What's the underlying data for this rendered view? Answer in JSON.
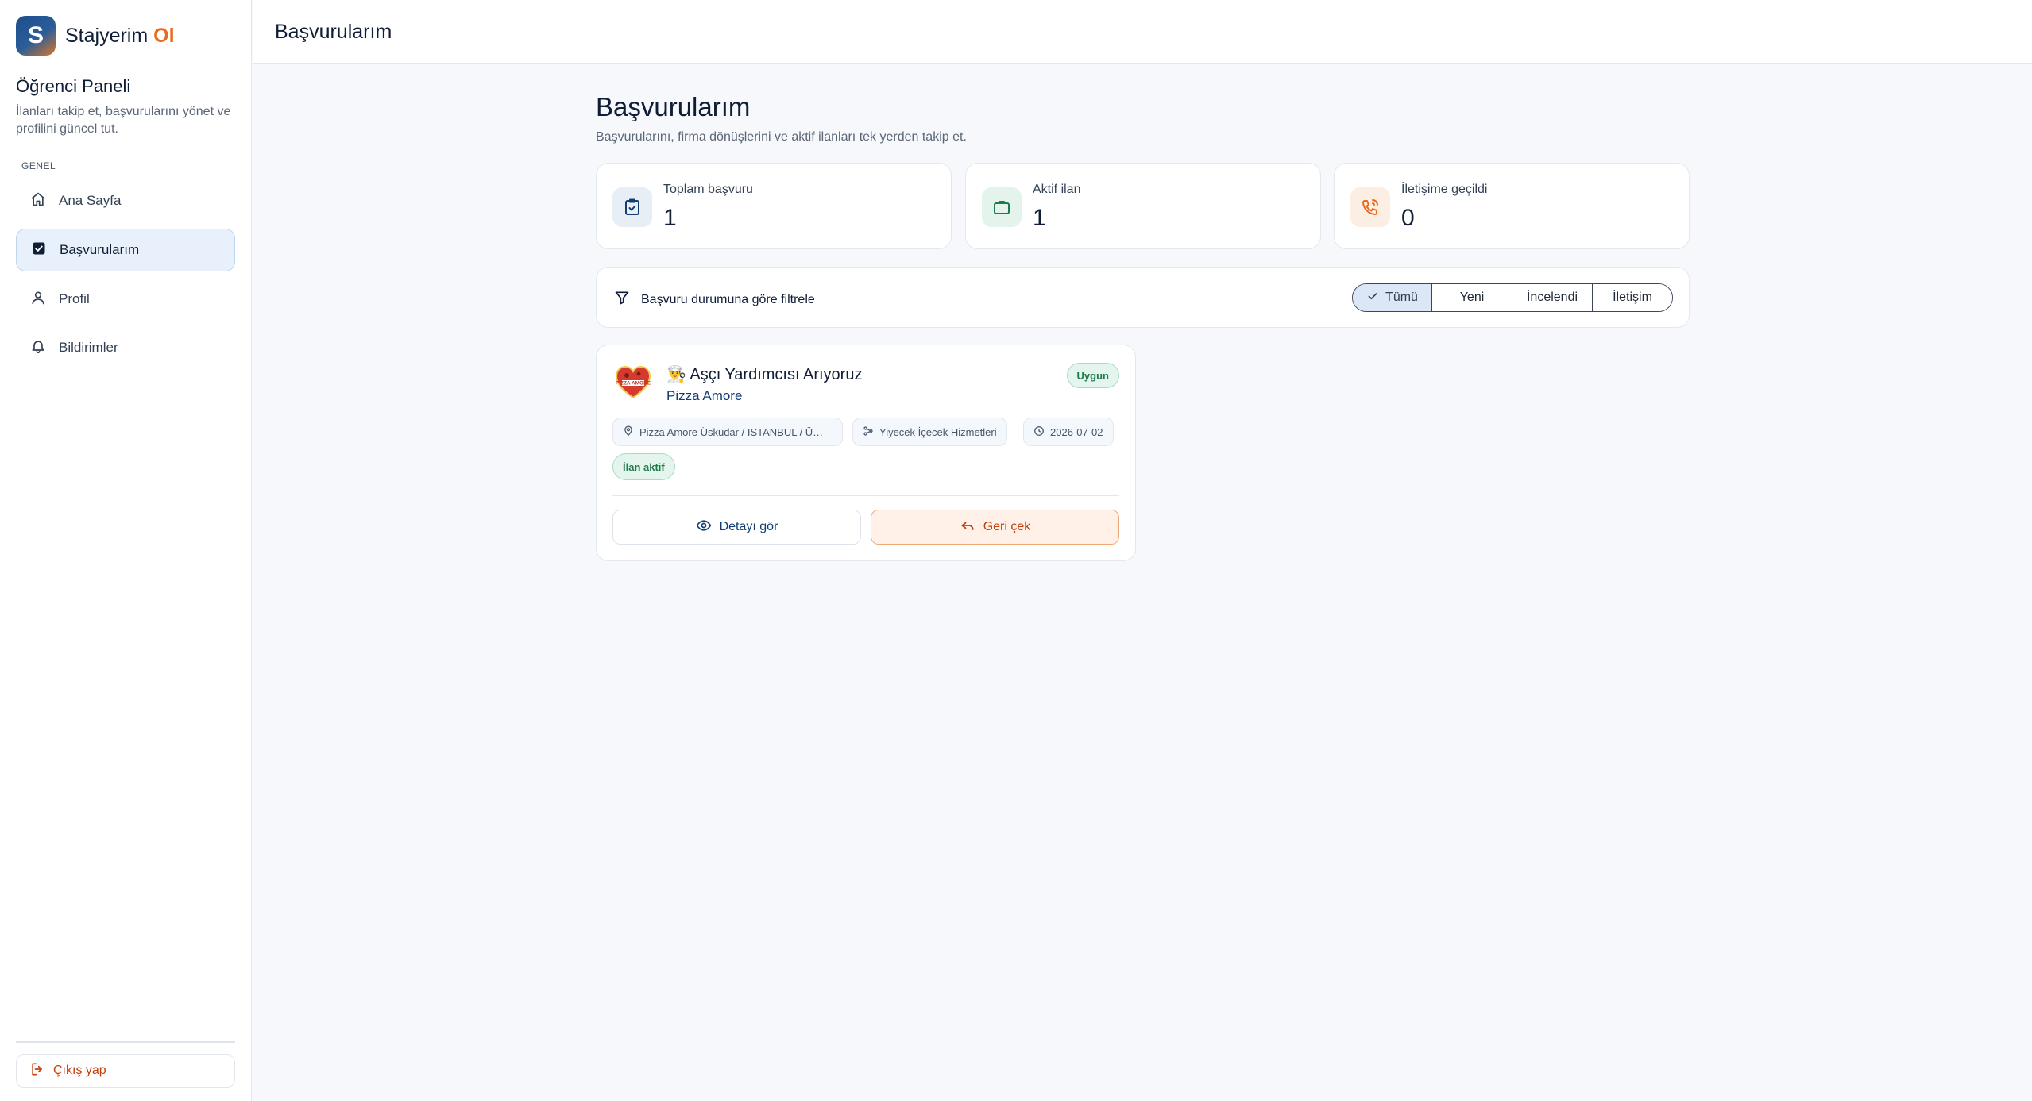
{
  "brand": {
    "logo_letter": "S",
    "name": "Stajyerim",
    "accent": "Ol"
  },
  "sidebar": {
    "panel_title": "Öğrenci Paneli",
    "panel_desc": "İlanları takip et, başvurularını yönet ve profilini güncel tut.",
    "section_label": "GENEL",
    "items": [
      {
        "label": "Ana Sayfa",
        "icon": "home-icon",
        "active": false
      },
      {
        "label": "Başvurularım",
        "icon": "checklist-icon",
        "active": true
      },
      {
        "label": "Profil",
        "icon": "user-icon",
        "active": false
      },
      {
        "label": "Bildirimler",
        "icon": "bell-icon",
        "active": false
      }
    ],
    "logout_label": "Çıkış yap"
  },
  "topbar": {
    "title": "Başvurularım"
  },
  "main": {
    "title": "Başvurularım",
    "subtitle": "Başvurularını, firma dönüşlerini ve aktif ilanları tek yerden takip et."
  },
  "stats": [
    {
      "label": "Toplam başvuru",
      "value": "1",
      "icon": "clipboard-check-icon",
      "color": "#123d73"
    },
    {
      "label": "Aktif ilan",
      "value": "1",
      "icon": "briefcase-icon",
      "color": "#1f7a4d"
    },
    {
      "label": "İletişime geçildi",
      "value": "0",
      "icon": "phone-call-icon",
      "color": "#ea6a1c"
    }
  ],
  "filter": {
    "label": "Başvuru durumuna göre filtrele",
    "options": [
      "Tümü",
      "Yeni",
      "İncelendi",
      "İletişim"
    ],
    "selected": "Tümü"
  },
  "applications": [
    {
      "title": "👨‍🍳 Aşçı Yardımcısı Arıyoruz",
      "company": "Pizza Amore",
      "logo_text": "PIZZA AMORE",
      "badge": "Uygun",
      "location": "Pizza Amore Üsküdar / ISTANBUL / Ü…",
      "sector": "Yiyecek İçecek Hizmetleri",
      "date": "2026-07-02",
      "status": "İlan aktif",
      "detail_label": "Detayı gör",
      "withdraw_label": "Geri çek"
    }
  ],
  "colors": {
    "primary": "#123d73",
    "accent": "#ea6a1c",
    "success": "#1f7a4d",
    "background": "#f6f8fb"
  }
}
